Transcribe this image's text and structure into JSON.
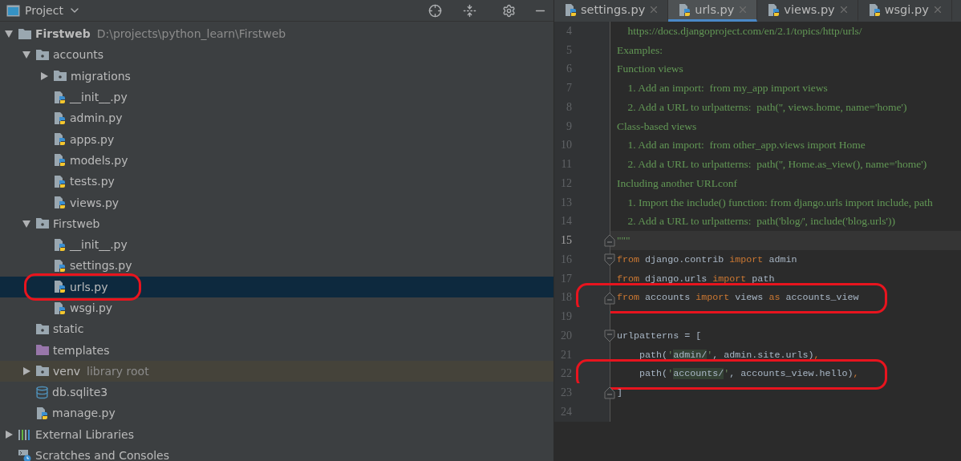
{
  "project_panel": {
    "title": "Project",
    "tree": [
      {
        "label": "Firstweb",
        "hint": "D:\\projects\\python_learn\\Firstweb",
        "kind": "project",
        "expanded": true,
        "selected": false,
        "children": [
          {
            "label": "accounts",
            "kind": "module",
            "expanded": true,
            "selected": false,
            "children": [
              {
                "label": "migrations",
                "kind": "module",
                "expanded": false,
                "selected": false
              },
              {
                "label": "__init__.py",
                "kind": "py",
                "selected": false
              },
              {
                "label": "admin.py",
                "kind": "py",
                "selected": false
              },
              {
                "label": "apps.py",
                "kind": "py",
                "selected": false
              },
              {
                "label": "models.py",
                "kind": "py",
                "selected": false
              },
              {
                "label": "tests.py",
                "kind": "py",
                "selected": false
              },
              {
                "label": "views.py",
                "kind": "py",
                "selected": false
              }
            ]
          },
          {
            "label": "Firstweb",
            "kind": "module",
            "expanded": true,
            "selected": false,
            "children": [
              {
                "label": "__init__.py",
                "kind": "py",
                "selected": false
              },
              {
                "label": "settings.py",
                "kind": "py",
                "selected": false
              },
              {
                "label": "urls.py",
                "kind": "py",
                "selected": true,
                "circled": true
              },
              {
                "label": "wsgi.py",
                "kind": "py",
                "selected": false
              }
            ]
          },
          {
            "label": "static",
            "kind": "module",
            "selected": false
          },
          {
            "label": "templates",
            "kind": "templates",
            "selected": false
          },
          {
            "label": "venv",
            "hint": "library root",
            "kind": "module",
            "library": true,
            "expanded": false,
            "selected": false
          },
          {
            "label": "db.sqlite3",
            "kind": "db",
            "selected": false
          },
          {
            "label": "manage.py",
            "kind": "py",
            "selected": false
          }
        ]
      },
      {
        "label": "External Libraries",
        "kind": "libs",
        "expanded": false,
        "selected": false
      },
      {
        "label": "Scratches and Consoles",
        "kind": "scratches",
        "selected": false
      }
    ]
  },
  "editor": {
    "tabs": [
      {
        "label": "settings.py",
        "selected": false
      },
      {
        "label": "urls.py",
        "selected": true
      },
      {
        "label": "views.py",
        "selected": false
      },
      {
        "label": "wsgi.py",
        "selected": false
      }
    ],
    "lines": [
      {
        "number": "4",
        "current": false,
        "tokens": [
          {
            "text": "    https://docs.djangoproject.com/en/2.1/topics/http/urls/",
            "kind": "doc"
          }
        ]
      },
      {
        "number": "5",
        "current": false,
        "tokens": [
          {
            "text": "Examples:",
            "kind": "doc"
          }
        ]
      },
      {
        "number": "6",
        "current": false,
        "tokens": [
          {
            "text": "Function views",
            "kind": "doc"
          }
        ]
      },
      {
        "number": "7",
        "current": false,
        "tokens": [
          {
            "text": "    1. Add an import:  from my_app import views",
            "kind": "doc"
          }
        ]
      },
      {
        "number": "8",
        "current": false,
        "tokens": [
          {
            "text": "    2. Add a URL to urlpatterns:  path('', views.home, name='home')",
            "kind": "doc"
          }
        ]
      },
      {
        "number": "9",
        "current": false,
        "tokens": [
          {
            "text": "Class-based views",
            "kind": "doc"
          }
        ]
      },
      {
        "number": "10",
        "current": false,
        "tokens": [
          {
            "text": "    1. Add an import:  from other_app.views import Home",
            "kind": "doc"
          }
        ]
      },
      {
        "number": "11",
        "current": false,
        "tokens": [
          {
            "text": "    2. Add a URL to urlpatterns:  path('', Home.as_view(), name='home')",
            "kind": "doc"
          }
        ]
      },
      {
        "number": "12",
        "current": false,
        "tokens": [
          {
            "text": "Including another URLconf",
            "kind": "doc"
          }
        ]
      },
      {
        "number": "13",
        "current": false,
        "tokens": [
          {
            "text": "    1. Import the include() function: from django.urls import include, path",
            "kind": "doc"
          }
        ]
      },
      {
        "number": "14",
        "current": false,
        "tokens": [
          {
            "text": "    2. Add a URL to urlpatterns:  path('blog/', include('blog.urls'))",
            "kind": "doc"
          }
        ]
      },
      {
        "number": "15",
        "current": true,
        "fold_marker": {
          "kind": "end"
        },
        "tokens": [
          {
            "text": "\"\"\"",
            "kind": "doc"
          }
        ]
      },
      {
        "number": "16",
        "current": false,
        "fold_marker": {
          "kind": "start"
        },
        "tokens": [
          {
            "text": "from",
            "kind": "kw"
          },
          {
            "text": " django.contrib ",
            "kind": "plain"
          },
          {
            "text": "import",
            "kind": "kw"
          },
          {
            "text": " admin",
            "kind": "plain"
          }
        ]
      },
      {
        "number": "17",
        "current": false,
        "tokens": [
          {
            "text": "from",
            "kind": "kw"
          },
          {
            "text": " django.urls ",
            "kind": "plain"
          },
          {
            "text": "import",
            "kind": "kw"
          },
          {
            "text": " path",
            "kind": "plain"
          }
        ]
      },
      {
        "number": "18",
        "current": false,
        "fold_marker": {
          "kind": "end"
        },
        "circled": true,
        "tokens": [
          {
            "text": "from",
            "kind": "kw"
          },
          {
            "text": " accounts ",
            "kind": "plain"
          },
          {
            "text": "import",
            "kind": "kw"
          },
          {
            "text": " views ",
            "kind": "plain"
          },
          {
            "text": "as",
            "kind": "kw"
          },
          {
            "text": " accounts_view",
            "kind": "plain"
          }
        ]
      },
      {
        "number": "19",
        "current": false
      },
      {
        "number": "20",
        "current": false,
        "fold_marker": {
          "kind": "start"
        },
        "tokens": [
          {
            "text": "urlpatterns = [",
            "kind": "plain"
          }
        ]
      },
      {
        "number": "21",
        "current": false,
        "tokens": [
          {
            "text": "    path(",
            "kind": "plain"
          },
          {
            "text": "'",
            "kind": "str"
          },
          {
            "text": "admin/",
            "kind": "match"
          },
          {
            "text": "'",
            "kind": "str"
          },
          {
            "text": ", admin.site.urls)",
            "kind": "plain"
          },
          {
            "text": ",",
            "kind": "kw"
          }
        ]
      },
      {
        "number": "22",
        "current": false,
        "circled": true,
        "tokens": [
          {
            "text": "    path(",
            "kind": "plain"
          },
          {
            "text": "'",
            "kind": "str"
          },
          {
            "text": "accounts/",
            "kind": "match"
          },
          {
            "text": "'",
            "kind": "str"
          },
          {
            "text": ", accounts_view.hello)",
            "kind": "plain"
          },
          {
            "text": ",",
            "kind": "kw"
          }
        ]
      },
      {
        "number": "23",
        "current": false,
        "fold_marker": {
          "kind": "end"
        },
        "tokens": [
          {
            "text": "]",
            "kind": "plain"
          }
        ]
      },
      {
        "number": "24",
        "current": false
      }
    ]
  }
}
